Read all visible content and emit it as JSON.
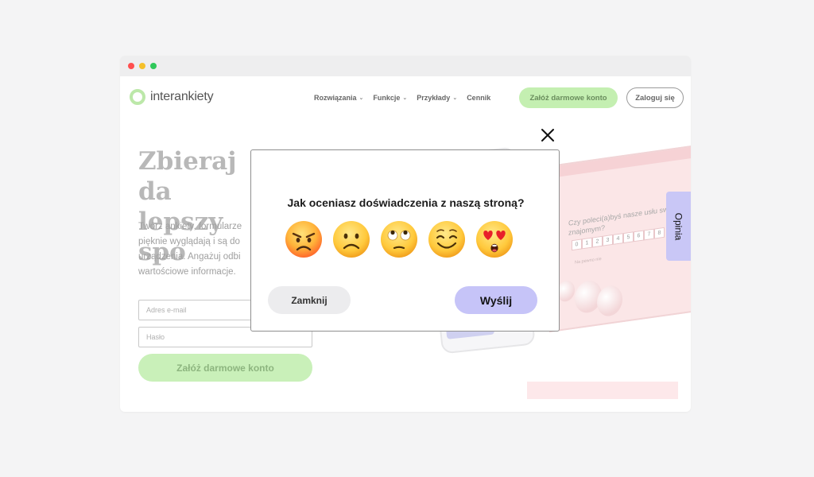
{
  "site": {
    "logo_text": "interankiety",
    "brand_color": "#bce8a9",
    "nav": [
      {
        "label": "Rozwiązania",
        "has_dropdown": true
      },
      {
        "label": "Funkcje",
        "has_dropdown": true
      },
      {
        "label": "Przykłady",
        "has_dropdown": true
      },
      {
        "label": "Cennik",
        "has_dropdown": false
      }
    ],
    "signup_top_label": "Załóż darmowe konto",
    "login_label": "Zaloguj się"
  },
  "hero": {
    "title": "Zbieraj da\nlepszy spo",
    "body": "Twórz ankiety, formularze pięknie wyglądają i są do urządzenia. Angażuj odbi wartościowe informacje.",
    "email_placeholder": "Adres e-mail",
    "password_placeholder": "Hasło",
    "signup_label": "Załóż darmowe konto"
  },
  "illustration": {
    "question": "Czy poleci(a)byś nasze usłu swoim znajomym?",
    "scale": [
      "0",
      "1",
      "2",
      "3",
      "4",
      "5",
      "6",
      "7",
      "8"
    ],
    "scale_label": "Na pewno nie"
  },
  "feedback_tab": {
    "label": "Opinia",
    "color": "#c9c7f6"
  },
  "modal": {
    "question": "Jak oceniasz doświadczenia z naszą stroną?",
    "emojis": [
      "angry-face",
      "frowning-face",
      "eye-roll-face",
      "smiling-face",
      "heart-eyes-face"
    ],
    "close_label": "Zamknij",
    "send_label": "Wyślij",
    "send_color": "#c6c4f8"
  }
}
